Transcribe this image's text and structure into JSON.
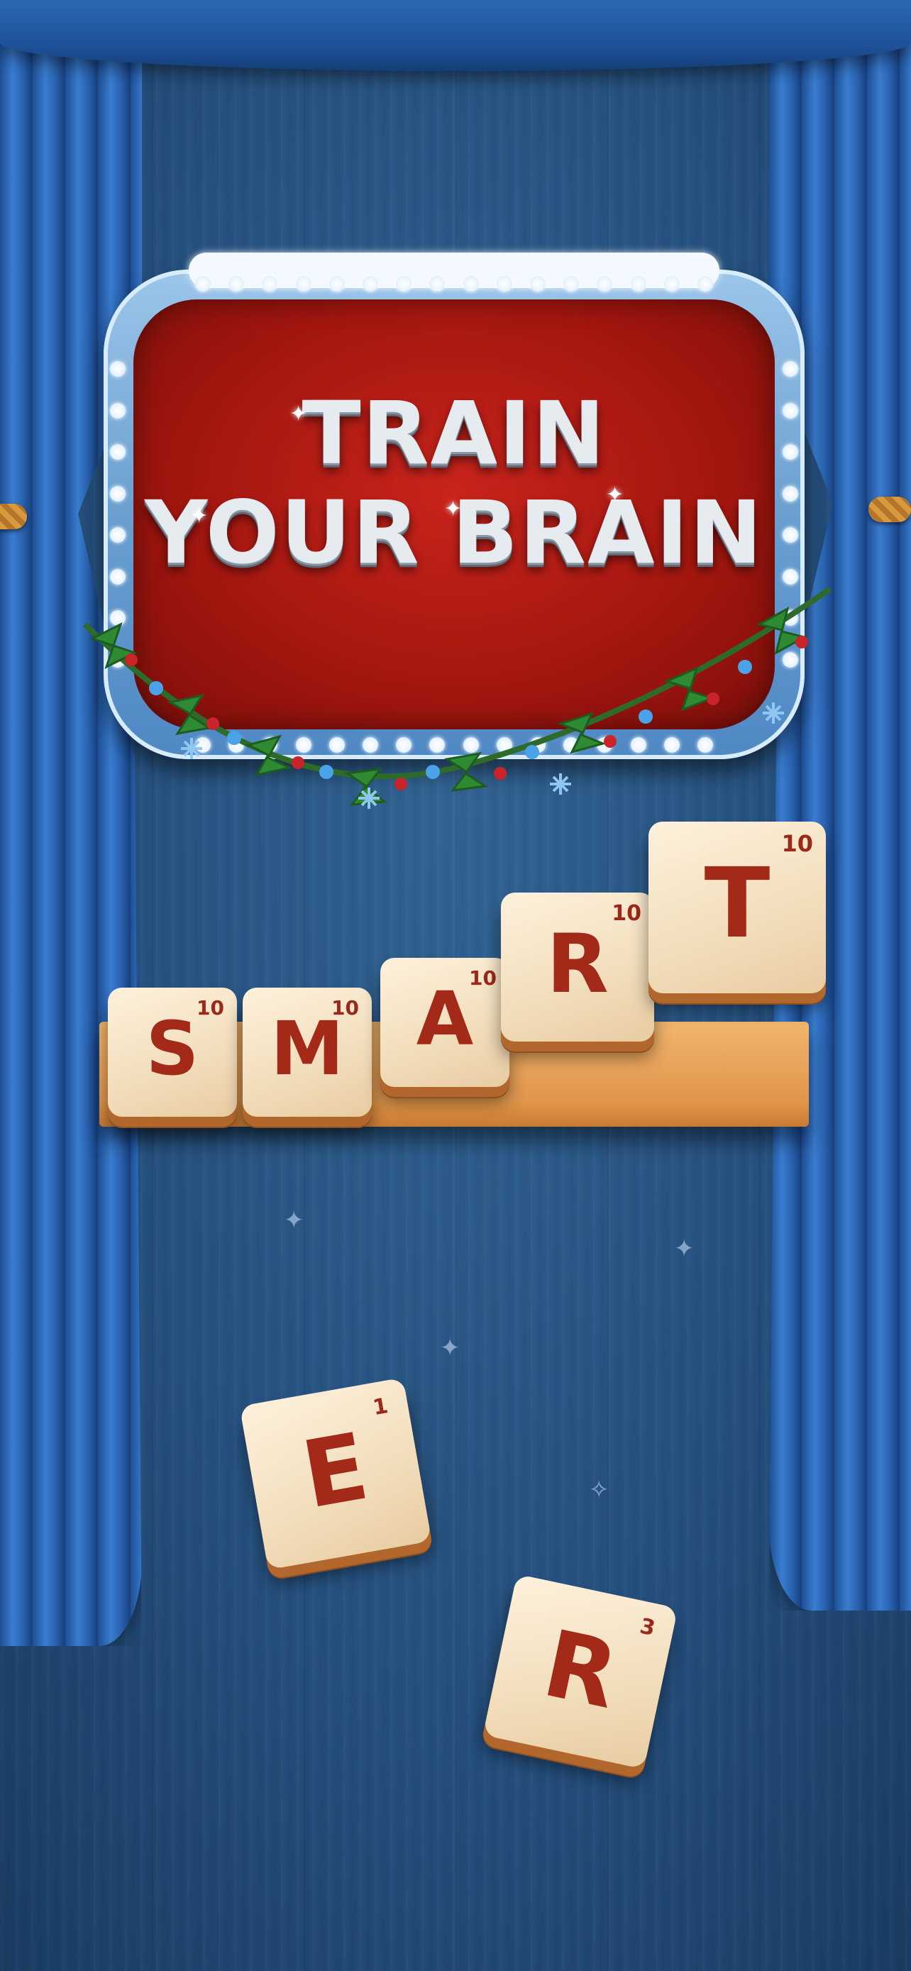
{
  "title": {
    "line1": "TRAIN",
    "line2": "YOUR BRAIN"
  },
  "shelf_tiles": [
    {
      "letter": "S",
      "points": "10"
    },
    {
      "letter": "M",
      "points": "10"
    },
    {
      "letter": "A",
      "points": "10"
    },
    {
      "letter": "R",
      "points": "10"
    },
    {
      "letter": "T",
      "points": "10"
    }
  ],
  "loose_tiles": [
    {
      "letter": "E",
      "points": "1"
    },
    {
      "letter": "R",
      "points": "3"
    }
  ],
  "colors": {
    "background": "#24507d",
    "curtain": "#2a63b0",
    "sign_red": "#b51c14",
    "tile_face": "#f3dfbe",
    "letter": "#a32a18",
    "shelf": "#e9a25a"
  }
}
